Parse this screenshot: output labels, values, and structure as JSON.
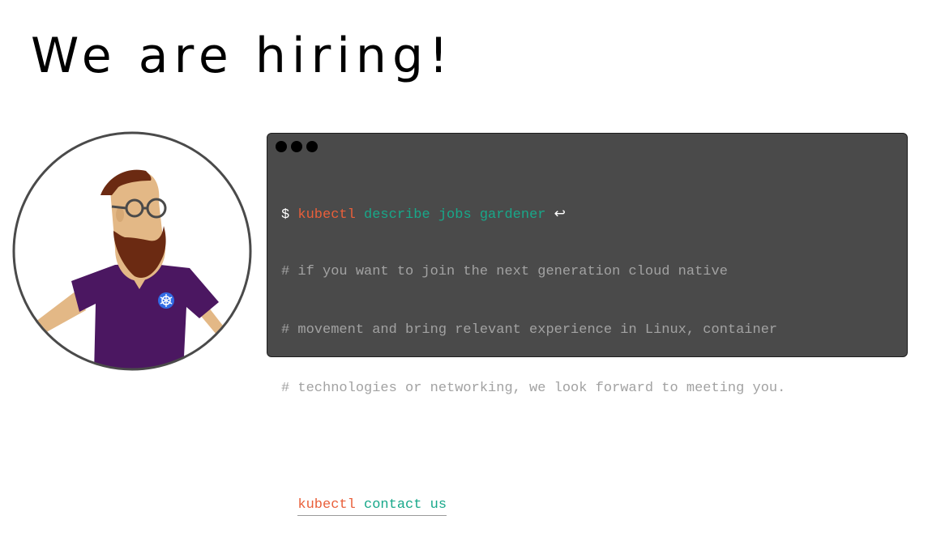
{
  "title": "We are hiring!",
  "terminal": {
    "line1": {
      "prompt": "$",
      "command": "kubectl",
      "args": "describe jobs gardener",
      "enter_symbol": "↩"
    },
    "comments": [
      "# if you want to join the next generation cloud native",
      "# movement and bring relevant experience in Linux, container",
      "# technologies or networking, we look forward to meeting you."
    ],
    "line2": {
      "prompt": "$",
      "command": "kubectl",
      "args": "contact us"
    }
  },
  "colors": {
    "terminal_bg": "#4a4a4a",
    "command": "#e95f3a",
    "argument": "#18a88a",
    "comment": "#a2a2a2",
    "shirt": "#4b1761",
    "beard": "#6b2a12",
    "skin": "#e3b886",
    "badge": "#326ce5"
  },
  "icons": {
    "avatar": "bearded-gardener-illustration",
    "badge": "kubernetes-helm-icon",
    "window_controls": "window-dots-icon",
    "enter": "return-arrow-icon"
  }
}
